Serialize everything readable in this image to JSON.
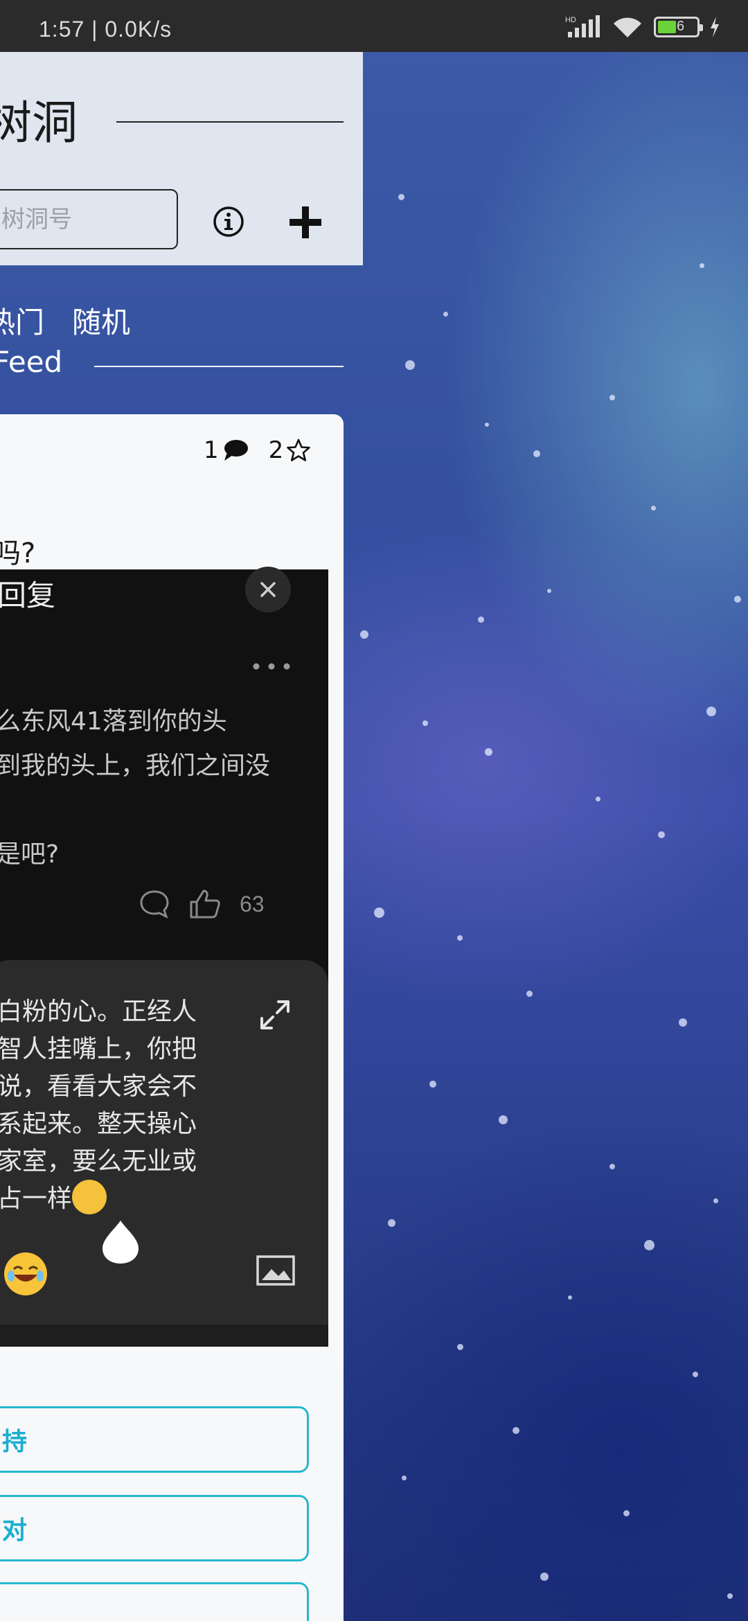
{
  "status_bar": {
    "time": "1:57 | 0.0K/s",
    "hd_label": "HD",
    "battery_level": "6"
  },
  "header": {
    "title": "树洞",
    "search": {
      "placeholder": "树洞号",
      "value": ""
    },
    "info_icon": "info-circle-icon",
    "add_icon": "plus-icon"
  },
  "tabs": {
    "hot": "热门",
    "random": "随机",
    "feed": "Feed"
  },
  "card": {
    "comment_count": "1",
    "star_count": "2",
    "title": "吗?",
    "embed": {
      "title": "回复",
      "body_lines": [
        "么东风41落到你的头",
        "到我的头上，我们之间没",
        "",
        "是吧?"
      ],
      "likes": "63"
    },
    "composer": {
      "lines": [
        "白粉的心。正经人",
        "智人挂嘴上，你把",
        "说，看看大家会不",
        "系起来。整天操心",
        "家室，要么无业或",
        "占一样"
      ]
    },
    "buttons": [
      {
        "label": "持"
      },
      {
        "label": "对"
      },
      {
        "label": ""
      }
    ]
  },
  "colors": {
    "accent": "#25b8cf",
    "header_bg": "#dfe6ef",
    "status_bar_bg": "#2b2b2b"
  }
}
